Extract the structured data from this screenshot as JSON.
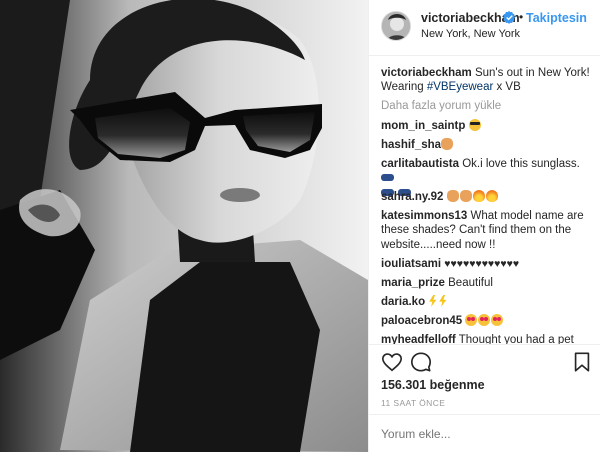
{
  "header": {
    "username": "victoriabeckham",
    "separator": "•",
    "follow_label": "Takiptesin",
    "location": "New York, New York"
  },
  "caption": {
    "username": "victoriabeckham",
    "text_before": "Sun's out in New York! Wearing ",
    "hashtag": "#VBEyewear",
    "text_after": " x VB"
  },
  "load_more": "Daha fazla yorum yükle",
  "comments": [
    {
      "user": "mom_in_saintp",
      "text": "",
      "emoji": [
        "sunglasses"
      ]
    },
    {
      "user": "hashif_sha",
      "text": "",
      "emoji": [
        "fire-hand"
      ]
    },
    {
      "user": "carlitabautista",
      "text": "Ok.i love this sunglass.",
      "emoji": [
        "shades",
        "shades",
        "shades"
      ]
    },
    {
      "user": "sahra.ny.92",
      "text": "",
      "emoji": [
        "hand",
        "hand",
        "fire",
        "fire"
      ]
    },
    {
      "user": "katesimmons13",
      "text": "What model name are these shades? Can't find them on the website.....need now !!",
      "emoji": []
    },
    {
      "user": "iouliatsami",
      "text": "♥♥♥♥♥♥♥♥♥♥♥♥",
      "emoji": []
    },
    {
      "user": "maria_prize",
      "text": "Beautiful",
      "emoji": []
    },
    {
      "user": "daria.ko",
      "text": "",
      "emoji": [
        "bolt",
        "bolt"
      ]
    },
    {
      "user": "paloacebron45",
      "text": "",
      "emoji": [
        "heart-eyes",
        "heart-eyes",
        "heart-eyes"
      ]
    },
    {
      "user": "myheadfelloff",
      "text": "Thought you had a pet crow on your shoulder :D",
      "emoji": []
    }
  ],
  "actions": {
    "like_icon": "heart-outline-icon",
    "comment_icon": "comment-bubble-icon",
    "save_icon": "bookmark-icon"
  },
  "likes": "156.301 beğenme",
  "time": "11 SAAT ÖNCE",
  "add_comment_placeholder": "Yorum ekle...",
  "colors": {
    "link_blue": "#3897f0",
    "hashtag": "#003569",
    "muted": "#999999",
    "border": "#efefef"
  }
}
